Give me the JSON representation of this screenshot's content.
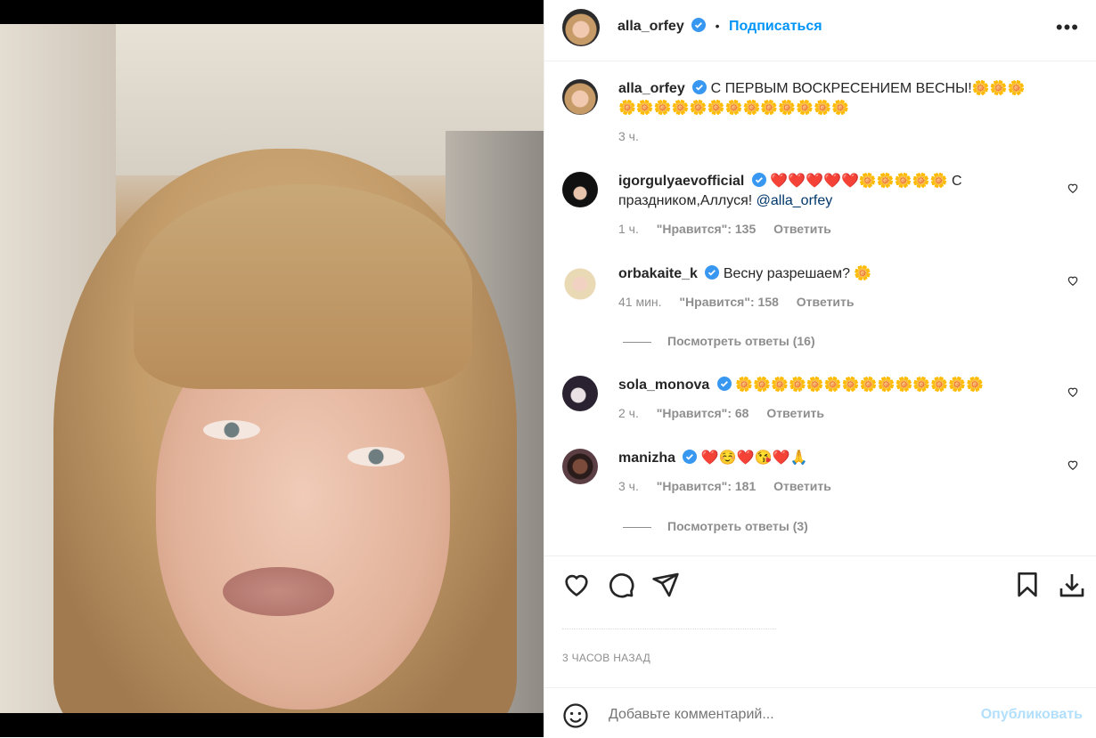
{
  "header": {
    "username": "alla_orfey",
    "dot": "•",
    "follow_label": "Подписаться",
    "more_label": "•••"
  },
  "caption": {
    "username": "alla_orfey",
    "text": "С ПЕРВЫМ ВОСКРЕСЕНИЕМ ВЕСНЫ!🌼🌼🌼🌼🌼🌼🌼🌼🌼🌼🌼🌼🌼🌼🌼🌼",
    "time": "3 ч."
  },
  "comments": [
    {
      "username": "igorgulyaevofficial",
      "text": "❤️❤️❤️❤️❤️🌼🌼🌼🌼🌼 С праздником,Аллуся! ",
      "mention": "@alla_orfey",
      "time": "1 ч.",
      "likes": "\"Нравится\": 135",
      "reply": "Ответить"
    },
    {
      "username": "orbakaite_k",
      "text": "Весну разрешаем? 🌼",
      "mention": "",
      "time": "41 мин.",
      "likes": "\"Нравится\": 158",
      "reply": "Ответить",
      "view_replies": "Посмотреть ответы (16)"
    },
    {
      "username": "sola_monova",
      "text": "🌼🌼🌼🌼🌼🌼🌼🌼🌼🌼🌼🌼🌼🌼",
      "mention": "",
      "time": "2 ч.",
      "likes": "\"Нравится\": 68",
      "reply": "Ответить"
    },
    {
      "username": "manizha",
      "text": "❤️☺️❤️😘❤️🙏",
      "mention": "",
      "time": "3 ч.",
      "likes": "\"Нравится\": 181",
      "reply": "Ответить",
      "view_replies": "Посмотреть ответы (3)"
    }
  ],
  "post_time": "3 ЧАСОВ НАЗАД",
  "add_comment": {
    "placeholder": "Добавьте комментарий...",
    "publish_label": "Опубликовать"
  },
  "colors": {
    "accent": "#0095f6",
    "text": "#262626",
    "muted": "#8e8e8e",
    "publish_disabled": "#b2dffc",
    "verified": "#3897f0"
  },
  "icons": [
    "like-icon",
    "comment-icon",
    "share-icon",
    "save-icon",
    "download-icon",
    "emoji-icon",
    "verified-badge-icon",
    "heart-small-icon",
    "more-options-icon"
  ]
}
